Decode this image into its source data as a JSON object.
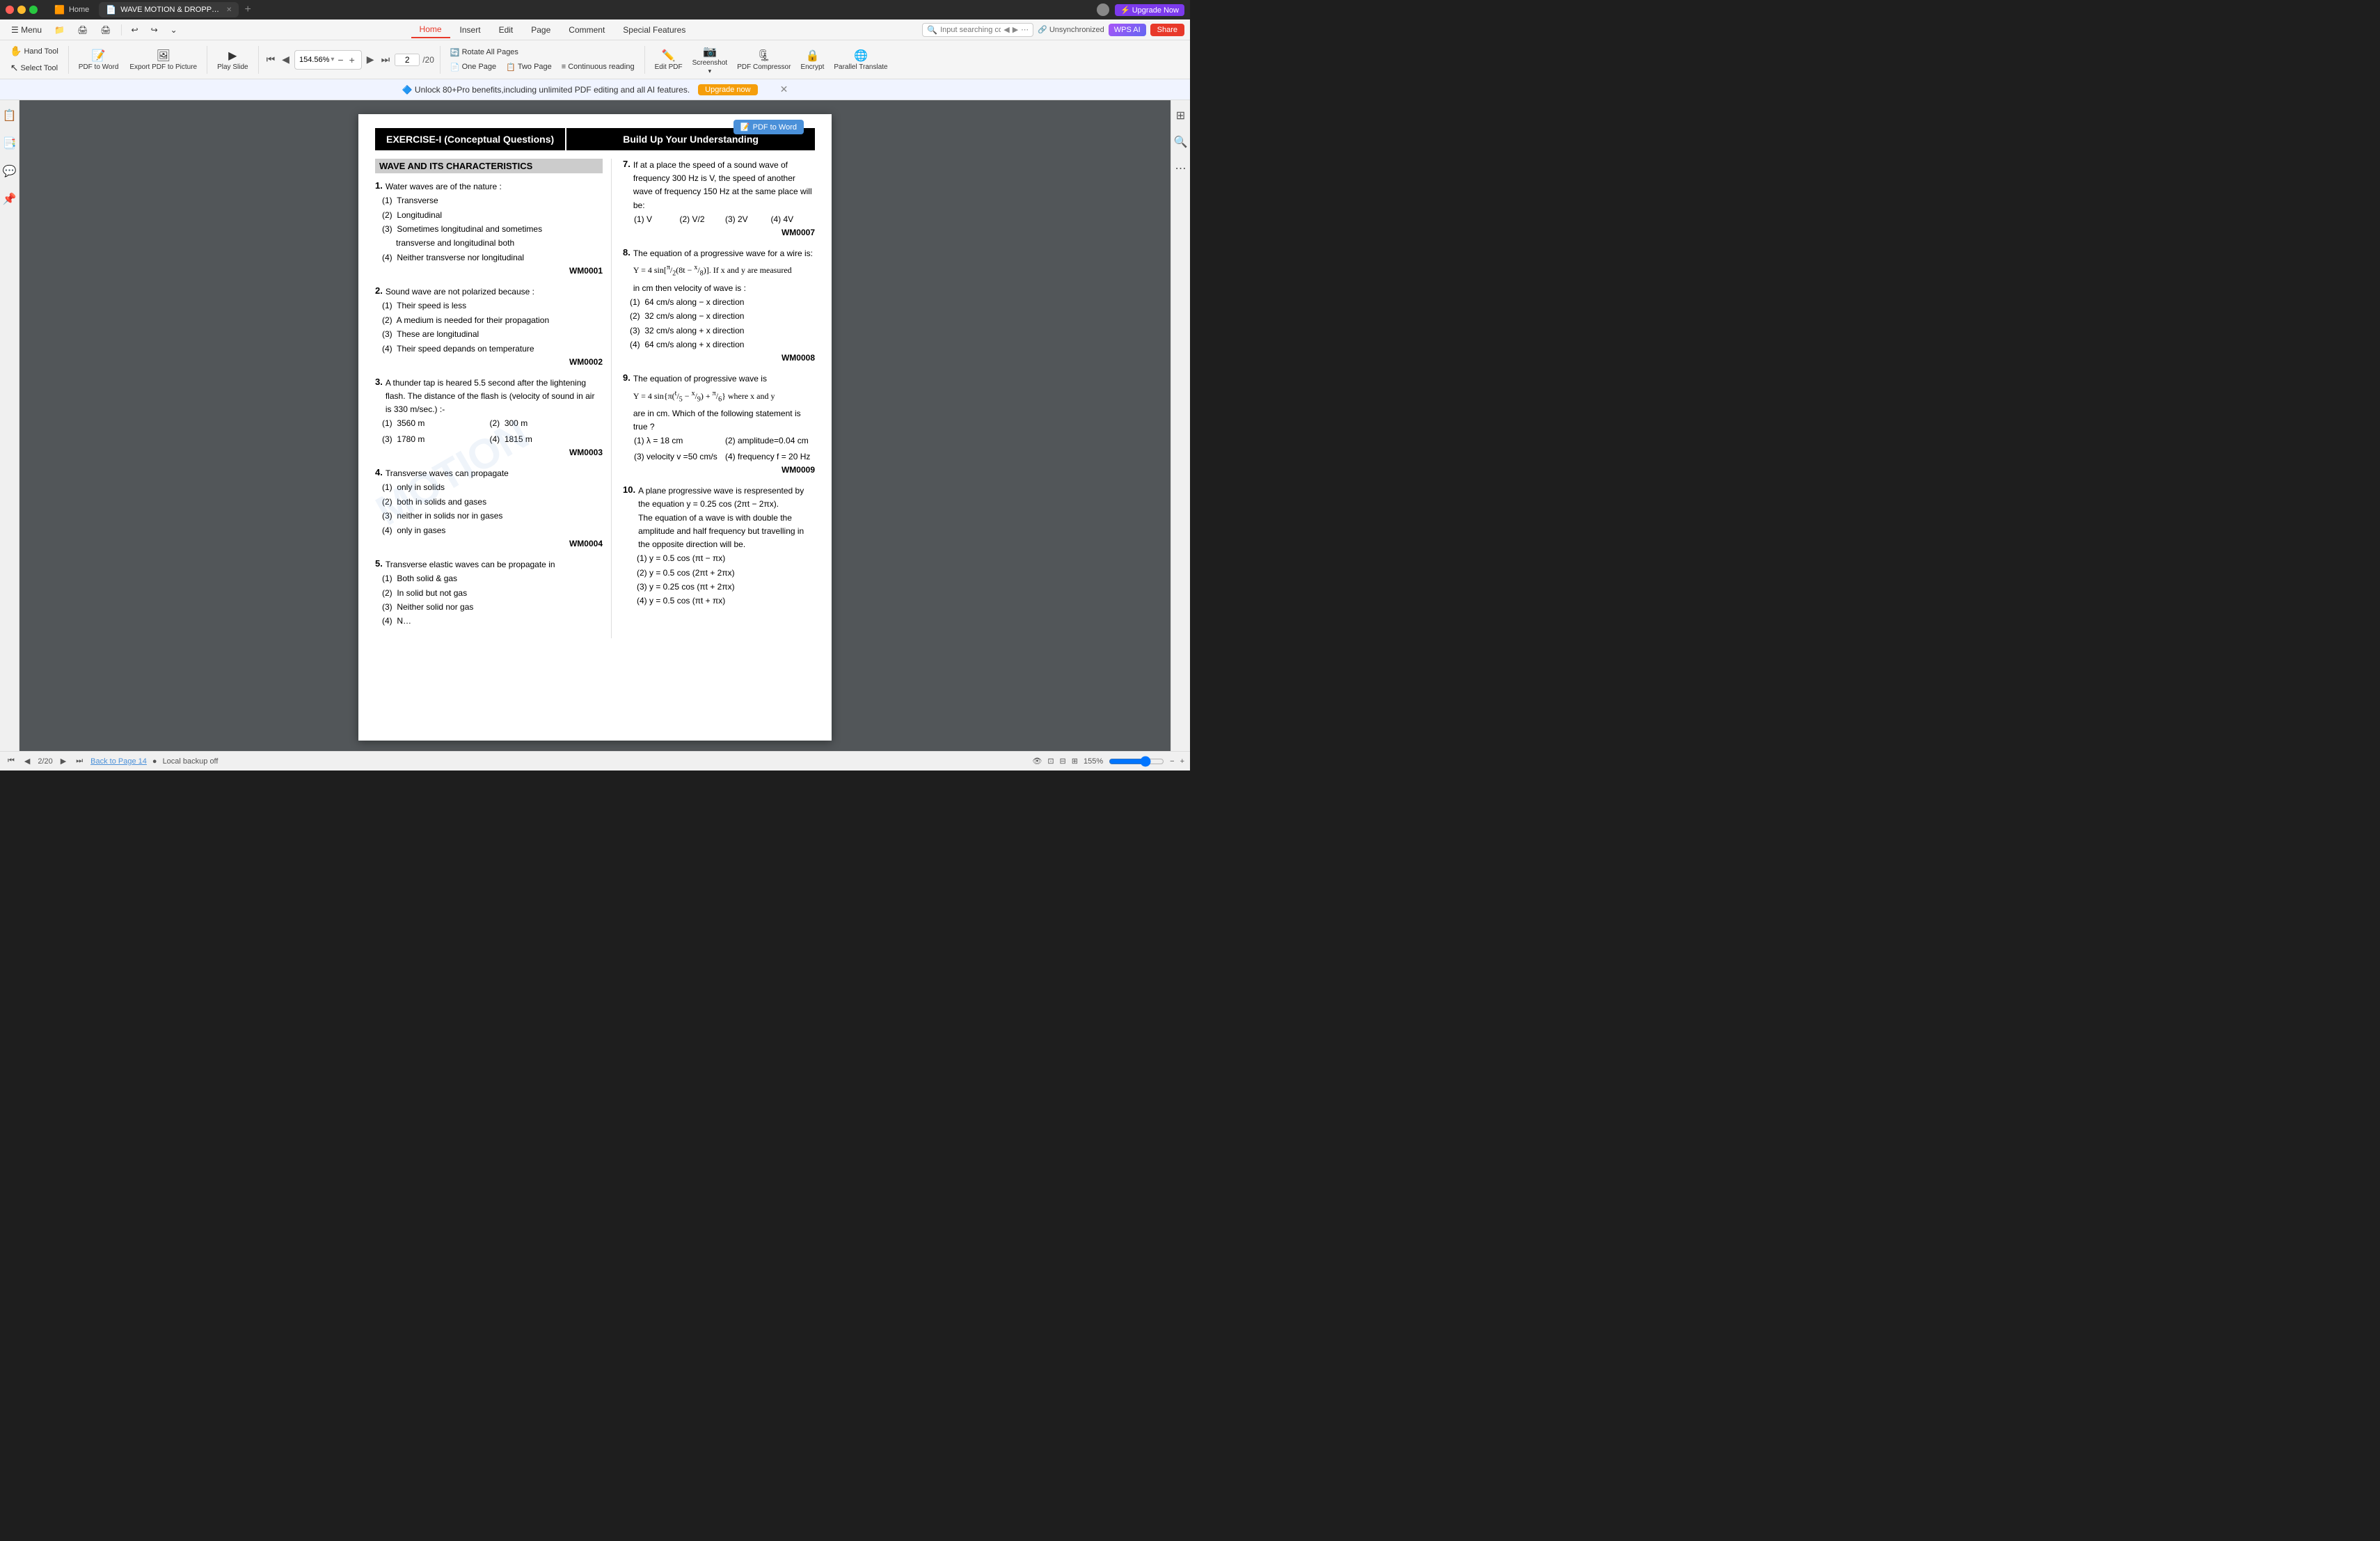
{
  "titlebar": {
    "tabs": [
      {
        "id": "home",
        "label": "Home",
        "icon": "🟧",
        "active": false
      },
      {
        "id": "wavemotion",
        "label": "WAVE MOTION & DROPP…",
        "icon": "📄",
        "active": true
      }
    ],
    "add_tab": "+",
    "upgrade_label": "⚡ Upgrade Now"
  },
  "menubar": {
    "left_items": [
      "☰ Menu",
      "📁",
      "🖨",
      "🖨",
      "↩",
      "↪",
      "⌄"
    ],
    "tabs": [
      "Home",
      "Insert",
      "Edit",
      "Page",
      "Comment",
      "Special Features"
    ],
    "active_tab": "Home",
    "search_placeholder": "Input searching co…",
    "unsync_label": "Unsynchronized",
    "wps_ai_label": "WPS AI",
    "share_label": "Share"
  },
  "toolbar": {
    "hand_tool": "Hand Tool",
    "select_tool": "Select Tool",
    "pdf_to_word": "PDF to Word",
    "export_pdf": "Export PDF to Picture",
    "play_slide": "Play Slide",
    "zoom_value": "154.56%",
    "zoom_out": "−",
    "zoom_in": "+",
    "first_page": "⏮",
    "prev_page": "◀",
    "current_page": "2",
    "total_pages": "20",
    "next_page": "▶",
    "last_page": "⏭",
    "rotate_all": "Rotate All Pages",
    "view_one": "One Page",
    "view_two": "Two Page",
    "view_continuous": "Continuous reading",
    "edit_pdf": "Edit PDF",
    "screenshot": "Screenshot",
    "pdf_compressor": "PDF Compressor",
    "encrypt": "Encrypt",
    "parallel_translate": "Parallel Translate"
  },
  "promo": {
    "text": "🔷 Unlock 80+Pro benefits,including unlimited PDF editing and all AI features.",
    "button": "Upgrade now",
    "close": "✕"
  },
  "pdf": {
    "header_left": "EXERCISE-I (Conceptual Questions)",
    "header_right": "Build Up Your Understanding",
    "section_title": "WAVE AND ITS CHARACTERISTICS",
    "questions_left": [
      {
        "num": "1.",
        "text": "Water waves are of the nature :",
        "options": [
          "(1)  Transverse",
          "(2)  Longitudinal",
          "(3)  Sometimes  longitudinal  and  sometimes transverse and longitudinal both",
          "(4)  Neither transverse nor longitudinal"
        ],
        "code": "WM0001"
      },
      {
        "num": "2.",
        "text": "Sound wave are not polarized because :",
        "options": [
          "(1)  Their speed is less",
          "(2)  A medium is needed for their propagation",
          "(3)  These are longitudinal",
          "(4)  Their speed depands on temperature"
        ],
        "code": "WM0002"
      },
      {
        "num": "3.",
        "text": "A thunder tap is heared 5.5 second after the lightening flash. The distance of the flash is (velocity of sound in air is 330 m/sec.) :-",
        "options": [
          "(1)  3560 m",
          "(2)  300 m",
          "(3)  1780 m",
          "(4)  1815 m"
        ],
        "code": "WM0003"
      },
      {
        "num": "4.",
        "text": "Transverse waves can propagate",
        "options": [
          "(1)  only in solids",
          "(2)  both in solids and gases",
          "(3)  neither in solids nor in gases",
          "(4)  only in gases"
        ],
        "code": "WM0004"
      },
      {
        "num": "5.",
        "text": "Transverse elastic waves can be propagate in",
        "options": [
          "(1)  Both solid & gas",
          "(2)  In solid but not gas",
          "(3)  Neither solid nor gas",
          "(4)  N…"
        ],
        "code": ""
      }
    ],
    "questions_right": [
      {
        "num": "7.",
        "text": "If  at  a  place  the  speed  of  a  sound  wave  of frequency  300  Hz  is  V,  the  speed  of  another wave of frequency 150 Hz at the same place will be:",
        "options": [
          "(1) V",
          "(2) V/2",
          "(3) 2V",
          "(4) 4V"
        ],
        "code": "WM0007"
      },
      {
        "num": "8.",
        "text": "The  equation  of  a  progressive  wave  for  a  wire  is: Y = 4 sin[π/2(8t − x/8)]. If x and y  are measured in cm then velocity of wave is :",
        "options": [
          "(1)  64 cm/s along − x direction",
          "(2)  32 cm/s along − x direction",
          "(3)  32 cm/s along  + x direction",
          "(4)  64 cm/s along + x direction"
        ],
        "code": "WM0008"
      },
      {
        "num": "9.",
        "text": "The  equation  of  progressive  wave  is Y = 4 sin{π(t/5 − x/9) + π/6} where x and y are in cm. Which of the following statement is true ?",
        "options": [
          "(1) λ = 18 cm",
          "(2) amplitude=0.04 cm",
          "(3) velocity v =50 cm/s",
          "(4) frequency f = 20 Hz"
        ],
        "code": "WM0009"
      },
      {
        "num": "10.",
        "text": "A  plane  progressive  wave  is  respresented  by  the equation y = 0.25 cos (2πt − 2πx). The  equation  of  a  wave  is  with  double  the amplitude and half frequency but travelling in the opposite direction will be.",
        "options": [
          "(1) y = 0.5 cos (πt − πx)",
          "(2) y = 0.5 cos (2πt + 2πx)",
          "(3) y = 0.25 cos (πt + 2πx)",
          "(4) y = 0.5 cos (πt + πx)"
        ],
        "code": ""
      }
    ],
    "pdf_to_word_float": "PDF to Word",
    "watermark": "MOTION"
  },
  "statusbar": {
    "page": "2/20",
    "back_to_page": "Back to Page 14",
    "backup": "Local backup off",
    "zoom_level": "155%"
  },
  "left_sidebar_icons": [
    "📋",
    "📑",
    "💬",
    "📌"
  ],
  "right_sidebar_icons": [
    "⊞",
    "🔍",
    "⋯"
  ]
}
